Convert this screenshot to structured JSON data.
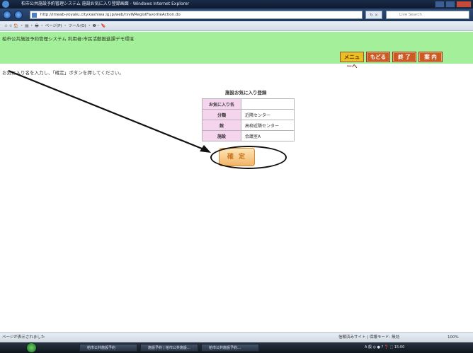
{
  "browser": {
    "title": "柏市公共施設予約管理システム 施設お気に入り登録画面 - Windows Internet Explorer",
    "url": "http://imeab-yoyaku.city.kashiwa.lg.jp/web/rsvWRegistFavoriteAction.do",
    "search_placeholder": "Live Search",
    "toolbar": "☆ ☆ 🏠 ・ ▤ ・ 🖶 ・ ページ(P) ・ ツール(O) ・ ❷・ 🔖"
  },
  "page": {
    "header_title": "柏市公共施設予約管理システム 利用者:市民活動推進課デモ環境",
    "nav": [
      {
        "label": "メニューへ"
      },
      {
        "label": "もどる"
      },
      {
        "label": "終 了"
      },
      {
        "label": "案 内"
      }
    ],
    "instruction": "お気に入り名を入力し、「確定」ボタンを押してください。",
    "form_title": "施設お気に入り登録",
    "form_rows": [
      {
        "label": "お気に入り名",
        "value": ""
      },
      {
        "label": "分類",
        "value": "近隣センター"
      },
      {
        "label": "館",
        "value": "高柳近隣センター"
      },
      {
        "label": "施設",
        "value": "会議室A"
      }
    ],
    "confirm_label": "確 定"
  },
  "status": {
    "left": "ページが表示されました",
    "zone": "信頼済みサイト | 保護モード: 無効",
    "zoom": "100%"
  },
  "taskbar": {
    "tasks": [
      "柏市公共施設予約",
      "施設予約 | 柏市公共施設…",
      "柏市公共施設予約…"
    ],
    "tray": "A 般 ◎ ● ? ❓ ⬚ 15:00"
  }
}
